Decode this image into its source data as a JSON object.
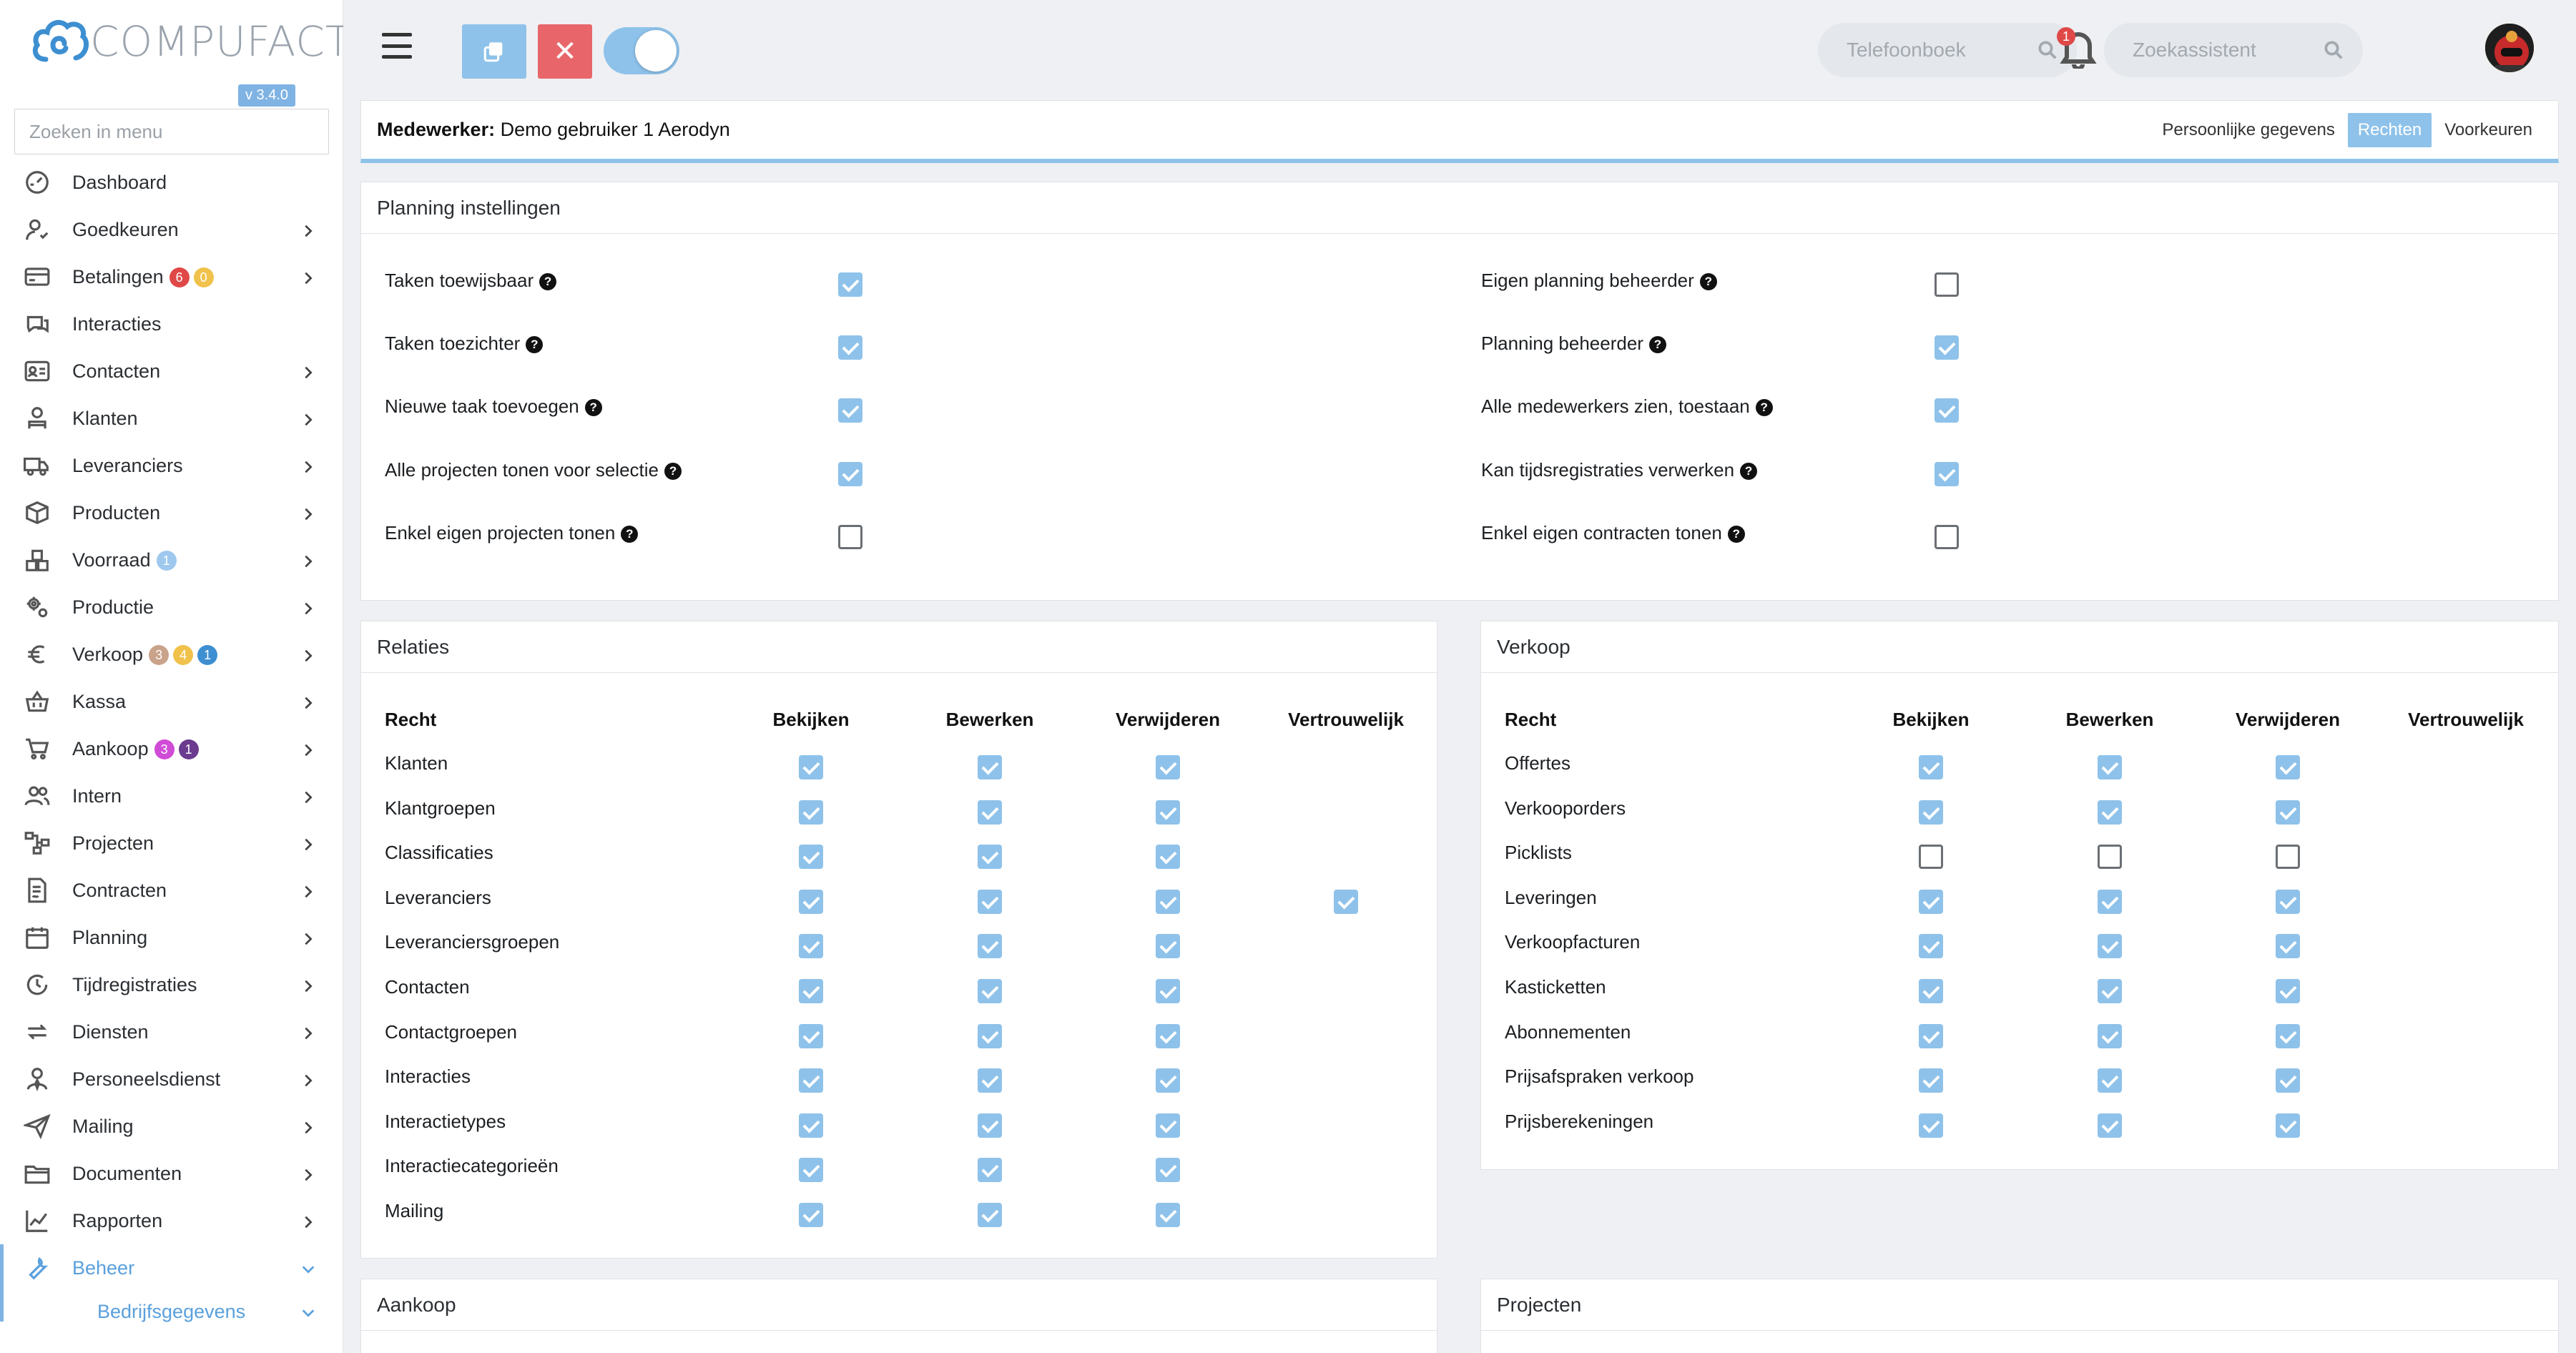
{
  "app": {
    "logo_text": "COMPUFACT",
    "version": "v 3.4.0"
  },
  "sidebar": {
    "search_placeholder": "Zoeken in menu",
    "items": [
      {
        "label": "Dashboard",
        "icon": "dashboard-icon",
        "chevron": false
      },
      {
        "label": "Goedkeuren",
        "icon": "user-check-icon",
        "chevron": true
      },
      {
        "label": "Betalingen",
        "icon": "card-icon",
        "chevron": true,
        "badges": [
          {
            "v": "6",
            "c": "#e04848"
          },
          {
            "v": "0",
            "c": "#f0c24b"
          }
        ]
      },
      {
        "label": "Interacties",
        "icon": "chat-icon",
        "chevron": false
      },
      {
        "label": "Contacten",
        "icon": "contact-card-icon",
        "chevron": true
      },
      {
        "label": "Klanten",
        "icon": "customer-icon",
        "chevron": true
      },
      {
        "label": "Leveranciers",
        "icon": "truck-icon",
        "chevron": true
      },
      {
        "label": "Producten",
        "icon": "box-icon",
        "chevron": true
      },
      {
        "label": "Voorraad",
        "icon": "boxes-icon",
        "chevron": true,
        "badges": [
          {
            "v": "1",
            "c": "#9ec8ee"
          }
        ]
      },
      {
        "label": "Productie",
        "icon": "gears-icon",
        "chevron": true
      },
      {
        "label": "Verkoop",
        "icon": "euro-icon",
        "chevron": true,
        "badges": [
          {
            "v": "3",
            "c": "#c9a38a"
          },
          {
            "v": "4",
            "c": "#f0c24b"
          },
          {
            "v": "1",
            "c": "#3d8fd1"
          }
        ]
      },
      {
        "label": "Kassa",
        "icon": "basket-icon",
        "chevron": true
      },
      {
        "label": "Aankoop",
        "icon": "cart-icon",
        "chevron": true,
        "badges": [
          {
            "v": "3",
            "c": "#d04bd6"
          },
          {
            "v": "1",
            "c": "#6b3b8f"
          }
        ]
      },
      {
        "label": "Intern",
        "icon": "users-icon",
        "chevron": true
      },
      {
        "label": "Projecten",
        "icon": "nodes-icon",
        "chevron": true
      },
      {
        "label": "Contracten",
        "icon": "contract-icon",
        "chevron": true
      },
      {
        "label": "Planning",
        "icon": "calendar-icon",
        "chevron": true
      },
      {
        "label": "Tijdregistraties",
        "icon": "clock-icon",
        "chevron": true
      },
      {
        "label": "Diensten",
        "icon": "repeat-icon",
        "chevron": true
      },
      {
        "label": "Personeelsdienst",
        "icon": "person-tie-icon",
        "chevron": true
      },
      {
        "label": "Mailing",
        "icon": "paper-plane-icon",
        "chevron": true
      },
      {
        "label": "Documenten",
        "icon": "folder-icon",
        "chevron": true
      },
      {
        "label": "Rapporten",
        "icon": "chart-line-icon",
        "chevron": true
      },
      {
        "label": "Beheer",
        "icon": "wrench-icon",
        "chevron": true,
        "active": true
      }
    ],
    "sub_item": "Bedrijfsgegevens"
  },
  "topbar": {
    "phonebook_placeholder": "Telefoonboek",
    "assistant_placeholder": "Zoekassistent",
    "notification_count": "1",
    "close_symbol": "✕"
  },
  "employee": {
    "prefix": "Medewerker:",
    "name": "Demo gebruiker 1 Aerodyn",
    "tabs": [
      "Persoonlijke gegevens",
      "Rechten",
      "Voorkeuren"
    ],
    "active_tab": "Rechten"
  },
  "planning": {
    "title": "Planning instellingen",
    "left": [
      {
        "label": "Taken toewijsbaar",
        "checked": true
      },
      {
        "label": "Taken toezichter",
        "checked": true
      },
      {
        "label": "Nieuwe taak toevoegen",
        "checked": true
      },
      {
        "label": "Alle projecten tonen voor selectie",
        "checked": true
      },
      {
        "label": "Enkel eigen projecten tonen",
        "checked": false
      }
    ],
    "right": [
      {
        "label": "Eigen planning beheerder",
        "checked": false
      },
      {
        "label": "Planning beheerder",
        "checked": true
      },
      {
        "label": "Alle medewerkers zien, toestaan",
        "checked": true
      },
      {
        "label": "Kan tijdsregistraties verwerken",
        "checked": true
      },
      {
        "label": "Enkel eigen contracten tonen",
        "checked": false
      }
    ]
  },
  "relaties": {
    "title": "Relaties",
    "headers": [
      "Recht",
      "Bekijken",
      "Bewerken",
      "Verwijderen",
      "Vertrouwelijk"
    ],
    "rows": [
      {
        "name": "Klanten",
        "v": [
          1,
          1,
          1,
          0
        ]
      },
      {
        "name": "Klantgroepen",
        "v": [
          1,
          1,
          1,
          0
        ]
      },
      {
        "name": "Classificaties",
        "v": [
          1,
          1,
          1,
          0
        ]
      },
      {
        "name": "Leveranciers",
        "v": [
          1,
          1,
          1,
          1
        ]
      },
      {
        "name": "Leveranciersgroepen",
        "v": [
          1,
          1,
          1,
          0
        ]
      },
      {
        "name": "Contacten",
        "v": [
          1,
          1,
          1,
          0
        ]
      },
      {
        "name": "Contactgroepen",
        "v": [
          1,
          1,
          1,
          0
        ]
      },
      {
        "name": "Interacties",
        "v": [
          1,
          1,
          1,
          0
        ]
      },
      {
        "name": "Interactietypes",
        "v": [
          1,
          1,
          1,
          0
        ]
      },
      {
        "name": "Interactiecategorieën",
        "v": [
          1,
          1,
          1,
          0
        ]
      },
      {
        "name": "Mailing",
        "v": [
          1,
          1,
          1,
          0
        ]
      }
    ]
  },
  "verkoop": {
    "title": "Verkoop",
    "headers": [
      "Recht",
      "Bekijken",
      "Bewerken",
      "Verwijderen",
      "Vertrouwelijk"
    ],
    "rows": [
      {
        "name": "Offertes",
        "v": [
          1,
          1,
          1
        ]
      },
      {
        "name": "Verkooporders",
        "v": [
          1,
          1,
          1
        ]
      },
      {
        "name": "Picklists",
        "v": [
          0,
          0,
          0
        ]
      },
      {
        "name": "Leveringen",
        "v": [
          1,
          1,
          1
        ]
      },
      {
        "name": "Verkoopfacturen",
        "v": [
          1,
          1,
          1
        ]
      },
      {
        "name": "Kasticketten",
        "v": [
          1,
          1,
          1
        ]
      },
      {
        "name": "Abonnementen",
        "v": [
          1,
          1,
          1
        ]
      },
      {
        "name": "Prijsafspraken verkoop",
        "v": [
          1,
          1,
          1
        ]
      },
      {
        "name": "Prijsberekeningen",
        "v": [
          1,
          1,
          1
        ]
      }
    ]
  },
  "aankoop": {
    "title": "Aankoop"
  },
  "projecten": {
    "title": "Projecten"
  }
}
